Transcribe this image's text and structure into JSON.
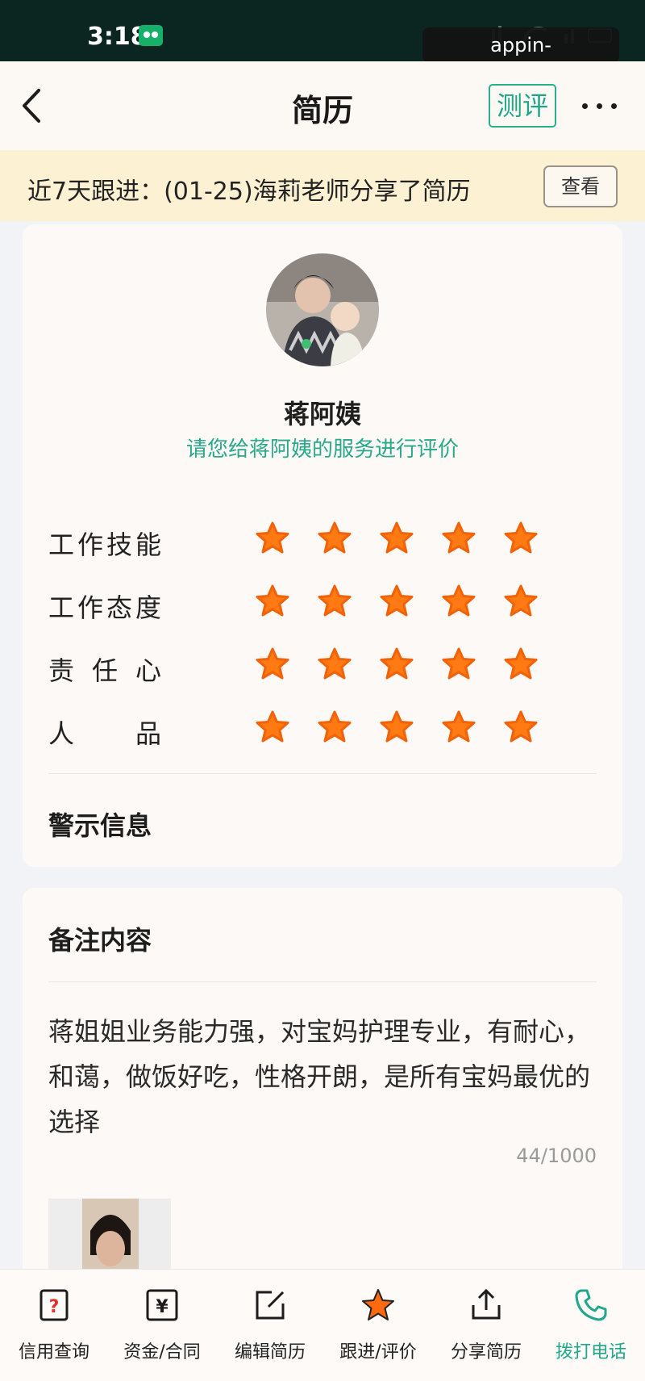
{
  "status_bar": {
    "time": "3:18",
    "app_icon": "panda-app-icon"
  },
  "watermark": "appin-kaiyun.com.cn",
  "header": {
    "title": "简历",
    "assess_label": "测评",
    "back_icon": "chevron-left-icon",
    "more_icon": "more-dots-icon"
  },
  "follow_bar": {
    "text": "近7天跟进：(01-25)海莉老师分享了简历",
    "view_label": "查看"
  },
  "profile": {
    "name": "蒋阿姨",
    "prompt": "请您给蒋阿姨的服务进行评价"
  },
  "ratings": [
    {
      "label": "工作技能",
      "stars": 5,
      "max": 5
    },
    {
      "label": "工作态度",
      "stars": 5,
      "max": 5
    },
    {
      "label": "责任心",
      "stars": 5,
      "max": 5
    },
    {
      "label": "人品",
      "stars": 5,
      "max": 5
    }
  ],
  "warning": {
    "heading": "警示信息"
  },
  "notes": {
    "heading": "备注内容",
    "body": "蒋姐姐业务能力强，对宝妈护理专业，有耐心，和蔼，做饭好吃，性格开朗，是所有宝妈最优的选择",
    "count": "44/1000"
  },
  "bottom_nav": [
    {
      "label": "信用查询",
      "icon": "credit-query-icon",
      "active": false
    },
    {
      "label": "资金/合同",
      "icon": "yen-icon",
      "active": false
    },
    {
      "label": "编辑简历",
      "icon": "edit-icon",
      "active": false
    },
    {
      "label": "跟进/评价",
      "icon": "star-icon",
      "active": false
    },
    {
      "label": "分享简历",
      "icon": "share-icon",
      "active": false
    },
    {
      "label": "拨打电话",
      "icon": "phone-icon",
      "active": true
    }
  ],
  "colors": {
    "accent": "#1fa889",
    "star": "#ff7a12",
    "status_bar": "#0b2620",
    "follow_bar": "#fcf1d3"
  }
}
